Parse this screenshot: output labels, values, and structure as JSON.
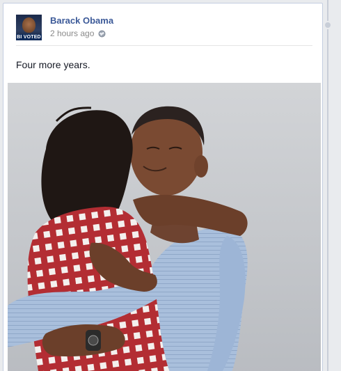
{
  "post": {
    "author": "Barack Obama",
    "timestamp": "2 hours ago",
    "privacy_icon": "globe-icon",
    "avatar_badge": "BI VOTED",
    "text": "Four more years."
  },
  "colors": {
    "author_link": "#3b5998",
    "timestamp": "#8a8a8a",
    "card_border": "#c4cde0",
    "page_background": "#e9ebee"
  }
}
